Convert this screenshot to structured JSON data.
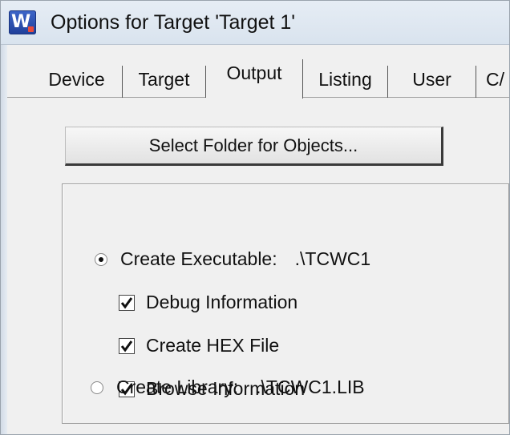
{
  "window": {
    "title": "Options for Target 'Target 1'"
  },
  "tabs": [
    {
      "label": "Device"
    },
    {
      "label": "Target"
    },
    {
      "label": "Output",
      "active": true
    },
    {
      "label": "Listing"
    },
    {
      "label": "User"
    },
    {
      "label": "C/"
    }
  ],
  "output": {
    "select_folder_button": "Select Folder for Objects...",
    "create_executable": {
      "label": "Create Executable:",
      "value": ".\\TCWC1",
      "selected": true
    },
    "debug_information": {
      "label": "Debug Information",
      "checked": true
    },
    "create_hex_file": {
      "label": "Create HEX File",
      "checked": true
    },
    "browse_information": {
      "label": "Browse Information",
      "checked": true
    },
    "create_library": {
      "label": "Create Library:",
      "value": ".\\TCWC1.LIB",
      "selected": false
    }
  },
  "icons": {
    "app": "uvision-icon",
    "annotation": "arrow-pointer-icon"
  }
}
